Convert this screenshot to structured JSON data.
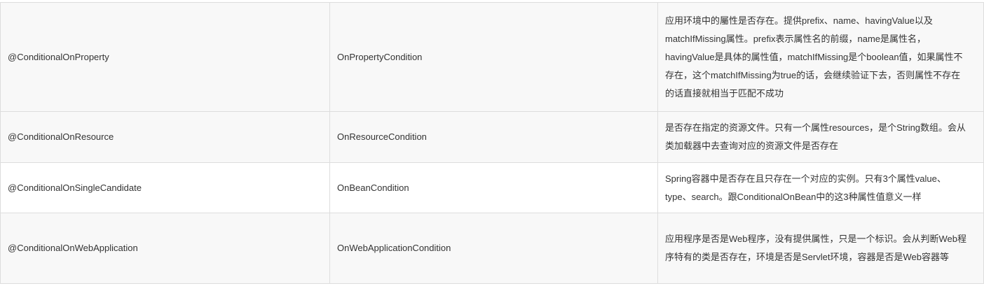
{
  "rows": [
    {
      "annotation": "@ConditionalOnProperty",
      "condition": "OnPropertyCondition",
      "description": "应用环境中的屬性是否存在。提供prefix、name、havingValue以及matchIfMissing属性。prefix表示属性名的前缀，name是属性名，havingValue是具体的属性值，matchIfMissing是个boolean值，如果属性不存在，这个matchIfMissing为true的话，会继续验证下去，否则属性不存在的话直接就相当于匹配不成功"
    },
    {
      "annotation": "@ConditionalOnResource",
      "condition": "OnResourceCondition",
      "description": "是否存在指定的资源文件。只有一个属性resources，是个String数组。会从类加载器中去查询对应的资源文件是否存在"
    },
    {
      "annotation": "@ConditionalOnSingleCandidate",
      "condition": "OnBeanCondition",
      "description": "Spring容器中是否存在且只存在一个对应的实例。只有3个属性value、type、search。跟ConditionalOnBean中的这3种属性值意义一样"
    },
    {
      "annotation": "@ConditionalOnWebApplication",
      "condition": "OnWebApplicationCondition",
      "description": "应用程序是否是Web程序，没有提供属性，只是一个标识。会从判断Web程序特有的类是否存在，环境是否是Servlet环境，容器是否是Web容器等"
    }
  ]
}
